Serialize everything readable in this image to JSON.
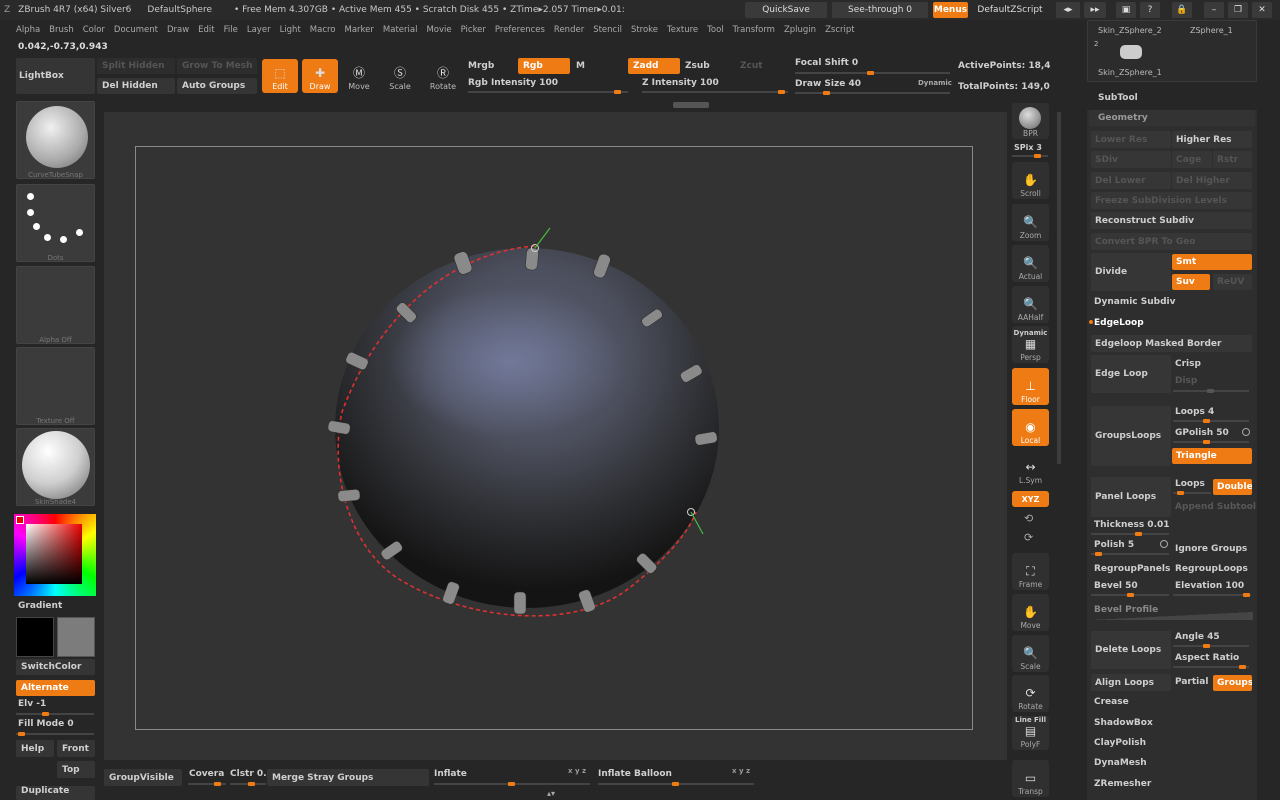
{
  "titlebar": {
    "items": [
      "ZBrush 4R7 (x64) Silver6",
      "DefaultSphere",
      "• Free Mem 4.307GB • Active Mem 455 • Scratch Disk 455 • ZTime▸2.057 Timer▸0.01:"
    ],
    "quicksave": "QuickSave",
    "seethrough": "See-through  0",
    "menus": "Menus",
    "zscript": "DefaultZScript"
  },
  "menu": [
    "Alpha",
    "Brush",
    "Color",
    "Document",
    "Draw",
    "Edit",
    "File",
    "Layer",
    "Light",
    "Macro",
    "Marker",
    "Material",
    "Movie",
    "Picker",
    "Preferences",
    "Render",
    "Stencil",
    "Stroke",
    "Texture",
    "Tool",
    "Transform",
    "Zplugin",
    "Zscript"
  ],
  "coords": "0.042,-0.73,0.943",
  "top": {
    "lightbox": "LightBox",
    "split_hidden": "Split Hidden",
    "grow_to_mesh": "Grow To Mesh",
    "del_hidden": "Del Hidden",
    "auto_groups": "Auto Groups",
    "edit": "Edit",
    "draw": "Draw",
    "move": "Move",
    "scale": "Scale",
    "rotate": "Rotate",
    "mrgb": "Mrgb",
    "rgb": "Rgb",
    "m": "M",
    "zadd": "Zadd",
    "zsub": "Zsub",
    "zcut": "Zcut",
    "rgb_intensity": "Rgb  Intensity 100",
    "z_intensity": "Z Intensity 100",
    "focal_shift": "Focal Shift 0",
    "draw_size": "Draw Size 40",
    "dynamic": "Dynamic",
    "active_points": "ActivePoints: 18,4",
    "total_points": "TotalPoints: 149,0"
  },
  "left": {
    "brush_cap": "CurveTubeSnap",
    "stroke_cap": "Dots",
    "alpha_cap": "Alpha  Off",
    "texture_cap": "Texture  Off",
    "material_cap": "SkinShade4",
    "gradient": "Gradient",
    "switchcolor": "SwitchColor",
    "alternate": "Alternate",
    "elv": "Elv -1",
    "fill_mode": "Fill Mode 0",
    "help": "Help",
    "front": "Front",
    "top": "Top",
    "duplicate": "Duplicate"
  },
  "bottom": {
    "groupvisible": "GroupVisible",
    "covera": "Covera",
    "clstr": "Clstr 0.",
    "merge_stray": "Merge Stray Groups",
    "inflate": "Inflate",
    "inflate_balloon": "Inflate Balloon"
  },
  "righttools": {
    "bpr": "BPR",
    "spix": "SPix 3",
    "scroll": "Scroll",
    "zoom": "Zoom",
    "actual": "Actual",
    "aahalf": "AAHalf",
    "dynamic": "Dynamic",
    "persp": "Persp",
    "floor": "Floor",
    "local": "Local",
    "lsym": "L.Sym",
    "xyz": "XYZ",
    "frame": "Frame",
    "move": "Move",
    "scale": "Scale",
    "rotate": "Rotate",
    "linefill": "Line Fill",
    "polyf": "PolyF",
    "transp": "Transp"
  },
  "subtools": {
    "item1": "Skin_ZSphere_2",
    "item2": "ZSphere_1",
    "num": "2",
    "item3": "Skin_ZSphere_1"
  },
  "panel": {
    "subtool": "SubTool",
    "geometry": "Geometry",
    "lower_res": "Lower Res",
    "higher_res": "Higher Res",
    "sdiv": "SDiv",
    "cage": "Cage",
    "rstr": "Rstr",
    "del_lower": "Del Lower",
    "del_higher": "Del Higher",
    "freeze": "Freeze SubDivision Levels",
    "reconstruct": "Reconstruct Subdiv",
    "convert_bpr": "Convert BPR To Geo",
    "divide": "Divide",
    "smt": "Smt",
    "suv": "Suv",
    "reuv": "ReUV",
    "dynamic_subdiv": "Dynamic Subdiv",
    "edgeloop": "EdgeLoop",
    "edgeloop_masked": "Edgeloop Masked Border",
    "edge_loop": "Edge Loop",
    "crisp": "Crisp",
    "disp": "Disp",
    "groupsloops": "GroupsLoops",
    "loops4": "Loops 4",
    "gpolish": "GPolish 50",
    "triangle": "Triangle",
    "panel_loops": "Panel Loops",
    "loops": "Loops",
    "double": "Double",
    "append": "Append  Subtool",
    "thickness": "Thickness 0.01",
    "polish": "Polish 5",
    "ignore_groups": "Ignore Groups",
    "regroup_panels": "RegroupPanels",
    "regroup_loops": "RegroupLoops",
    "bevel": "Bevel 50",
    "elevation": "Elevation 100",
    "bevel_profile": "Bevel Profile",
    "delete_loops": "Delete Loops",
    "angle": "Angle 45",
    "aspect_ratio": "Aspect Ratio",
    "align_loops": "Align Loops",
    "partial": "Partial",
    "groups": "Groups",
    "crease": "Crease",
    "shadowbox": "ShadowBox",
    "claypolish": "ClayPolish",
    "dynamesh": "DynaMesh",
    "zremesher": "ZRemesher"
  },
  "colors": {
    "accent": "#ee7b14",
    "canvas": "#333333",
    "panel": "#2e2e2e"
  }
}
